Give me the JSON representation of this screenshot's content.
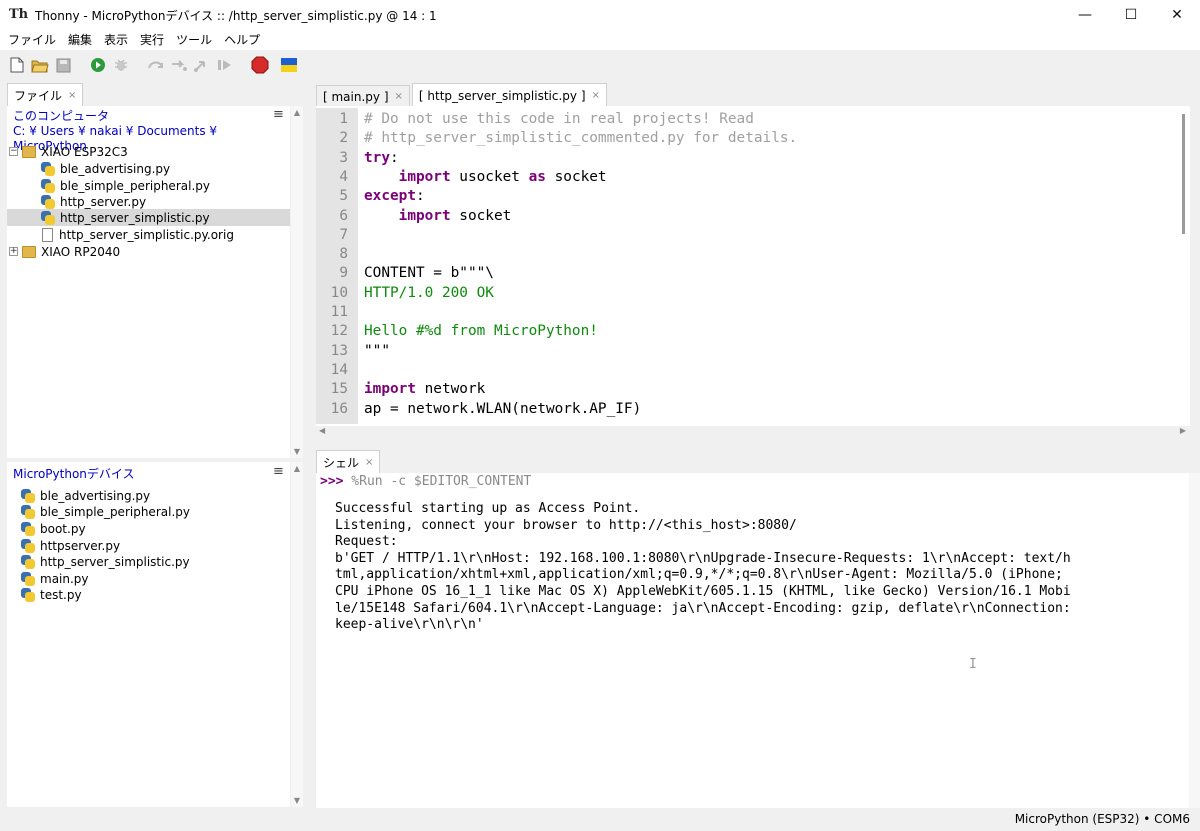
{
  "window": {
    "app_name": "Thonny",
    "title": "Thonny  -  MicroPythonデバイス :: /http_server_simplistic.py  @  14 : 1",
    "minimize": "—",
    "maximize": "☐",
    "close": "✕"
  },
  "menu": [
    "ファイル",
    "編集",
    "表示",
    "実行",
    "ツール",
    "ヘルプ"
  ],
  "toolbar": {
    "icons": [
      "new-file-icon",
      "open-folder-icon",
      "save-icon",
      "run-icon",
      "debug-icon",
      "step-over-icon",
      "step-into-icon",
      "step-out-icon",
      "resume-icon",
      "stop-icon",
      "ukraine-flag-icon"
    ],
    "stop_label": "STOP"
  },
  "files_panel": {
    "tab_label": "ファイル",
    "tab_close": "×",
    "computer_heading": "このコンピュータ",
    "computer_path": "C: ¥ Users ¥ nakai ¥ Documents ¥ MicroPython",
    "tree": [
      {
        "label": "XIAO ESP32C3",
        "type": "folder",
        "expander": "−"
      },
      {
        "label": "ble_advertising.py",
        "type": "py"
      },
      {
        "label": "ble_simple_peripheral.py",
        "type": "py"
      },
      {
        "label": "http_server.py",
        "type": "py"
      },
      {
        "label": "http_server_simplistic.py",
        "type": "py",
        "selected": true
      },
      {
        "label": "http_server_simplistic.py.orig",
        "type": "file"
      },
      {
        "label": "XIAO RP2040",
        "type": "folder",
        "expander": "+"
      }
    ],
    "device_heading": "MicroPythonデバイス",
    "device_files": [
      "ble_advertising.py",
      "ble_simple_peripheral.py",
      "boot.py",
      "httpserver.py",
      "http_server_simplistic.py",
      "main.py",
      "test.py"
    ],
    "menu_glyph": "≡"
  },
  "editor": {
    "tabs": [
      {
        "label": "[ main.py ]",
        "close": "×",
        "active": false
      },
      {
        "label": "[ http_server_simplistic.py ]",
        "close": "×",
        "active": true
      }
    ],
    "line_numbers": [
      "1",
      "2",
      "3",
      "4",
      "5",
      "6",
      "7",
      "8",
      "9",
      "10",
      "11",
      "12",
      "13",
      "14",
      "15",
      "16"
    ],
    "lines": [
      [
        {
          "t": "# Do not use this code in real projects! Read",
          "c": "cm"
        }
      ],
      [
        {
          "t": "# http_server_simplistic_commented.py for details.",
          "c": "cm"
        }
      ],
      [
        {
          "t": "try",
          "c": "kw"
        },
        {
          "t": ":",
          "c": "nm"
        }
      ],
      [
        {
          "t": "    ",
          "c": "nm"
        },
        {
          "t": "import",
          "c": "kw"
        },
        {
          "t": " usocket ",
          "c": "nm"
        },
        {
          "t": "as",
          "c": "kw"
        },
        {
          "t": " socket",
          "c": "nm"
        }
      ],
      [
        {
          "t": "except",
          "c": "kw"
        },
        {
          "t": ":",
          "c": "nm"
        }
      ],
      [
        {
          "t": "    ",
          "c": "nm"
        },
        {
          "t": "import",
          "c": "kw"
        },
        {
          "t": " socket",
          "c": "nm"
        }
      ],
      [],
      [],
      [
        {
          "t": "CONTENT = b\"\"\"\\",
          "c": "nm"
        }
      ],
      [
        {
          "t": "HTTP/1.0 200 OK",
          "c": "st"
        }
      ],
      [],
      [
        {
          "t": "Hello #%d from MicroPython!",
          "c": "st"
        }
      ],
      [
        {
          "t": "\"\"\"",
          "c": "nm"
        }
      ],
      [],
      [
        {
          "t": "import",
          "c": "kw"
        },
        {
          "t": " network",
          "c": "nm"
        }
      ],
      [
        {
          "t": "ap = network.WLAN(network.AP_IF)",
          "c": "nm"
        }
      ]
    ]
  },
  "shell": {
    "tab_label": "シェル",
    "tab_close": "×",
    "prompt": ">>>",
    "command": " %Run -c $EDITOR_CONTENT",
    "output": [
      "Successful starting up as Access Point.",
      "Listening, connect your browser to http://<this_host>:8080/",
      "Request:",
      "b'GET / HTTP/1.1\\r\\nHost: 192.168.100.1:8080\\r\\nUpgrade-Insecure-Requests: 1\\r\\nAccept: text/h",
      "tml,application/xhtml+xml,application/xml;q=0.9,*/*;q=0.8\\r\\nUser-Agent: Mozilla/5.0 (iPhone;",
      "CPU iPhone OS 16_1_1 like Mac OS X) AppleWebKit/605.1.15 (KHTML, like Gecko) Version/16.1 Mobi",
      "le/15E148 Safari/604.1\\r\\nAccept-Language: ja\\r\\nAccept-Encoding: gzip, deflate\\r\\nConnection:",
      "keep-alive\\r\\n\\r\\n'"
    ]
  },
  "status": {
    "text": "MicroPython (ESP32)  •  COM6"
  },
  "colors": {
    "keyword": "#7a0078",
    "string": "#0e8a0e",
    "comment": "#a0a0a0",
    "link_blue": "#0000c0"
  }
}
